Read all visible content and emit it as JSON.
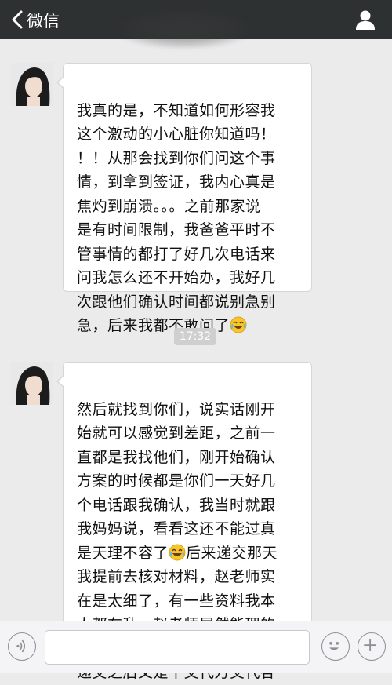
{
  "header": {
    "back_label": "微信",
    "back_icon": "chevron-left-icon",
    "profile_icon": "user-icon",
    "background": "#2e3132"
  },
  "messages": [
    {
      "sender": "contact",
      "text": "我真的是，不知道如何形容我\n这个激动的小心脏你知道吗！\n！！从那会找到你们问这个事\n情，到拿到签证，我内心真是\n焦灼到崩溃。。。之前那家说\n是有时间限制，我爸爸平时不\n管事情的都打了好几次电话来\n问我怎么还不开始办，我好几\n次跟他们确认时间都说别急别\n急，后来我都不敢问了",
      "emoji": "tears-of-joy-emoji"
    },
    {
      "sender": "contact",
      "text_before_emoji": "然后就找到你们，说实话刚开\n始就可以感觉到差距，之前一\n直都是我找他们，刚开始确认\n方案的时候都是你们一天好几\n个电话跟我确认，我当时就跟\n我妈妈说，看看这还不能过真\n是天理不容了",
      "emoji": "tears-of-joy-emoji",
      "text_after_emoji": "后来递交那天\n我提前去核对材料，赵老师实\n在是太细了，有一些资料我本\n人都在乱，赵老师居然能理的\n一条条的，真是太佩服了。等\n递交之后又是千交代万交代各"
    }
  ],
  "timestamp": "17:32",
  "input_bar": {
    "voice_icon": "voice-icon",
    "emoji_icon": "smiley-icon",
    "more_icon": "plus-icon",
    "placeholder": ""
  }
}
